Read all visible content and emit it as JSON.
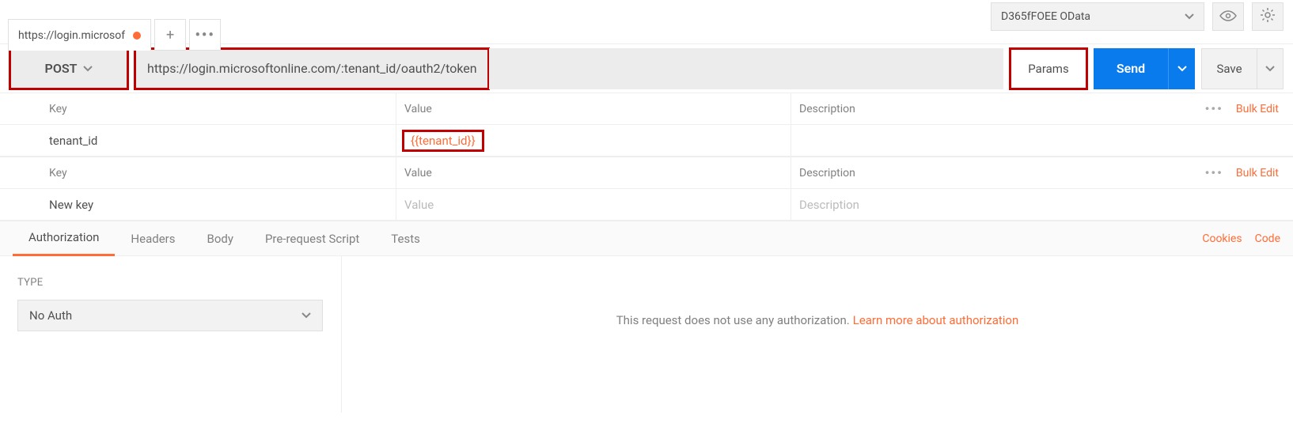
{
  "header": {
    "tab_title": "https://login.microsof",
    "environment": "D365fFOEE OData"
  },
  "request": {
    "method": "POST",
    "url": "https://login.microsoftonline.com/:tenant_id/oauth2/token",
    "params_btn": "Params",
    "send_btn": "Send",
    "save_btn": "Save"
  },
  "path_params": {
    "headers": {
      "key": "Key",
      "value": "Value",
      "description": "Description"
    },
    "row": {
      "key": "tenant_id",
      "value": "{{tenant_id}}"
    },
    "bulk_edit": "Bulk Edit"
  },
  "query_params": {
    "headers": {
      "key": "Key",
      "value": "Value",
      "description": "Description"
    },
    "placeholders": {
      "key": "New key",
      "value": "Value",
      "description": "Description"
    },
    "bulk_edit": "Bulk Edit"
  },
  "tabs": {
    "authorization": "Authorization",
    "headers": "Headers",
    "body": "Body",
    "prerequest": "Pre-request Script",
    "tests": "Tests",
    "cookies": "Cookies",
    "code": "Code"
  },
  "auth": {
    "type_label": "TYPE",
    "type_value": "No Auth",
    "message": "This request does not use any authorization.",
    "learn": "Learn more about authorization"
  }
}
